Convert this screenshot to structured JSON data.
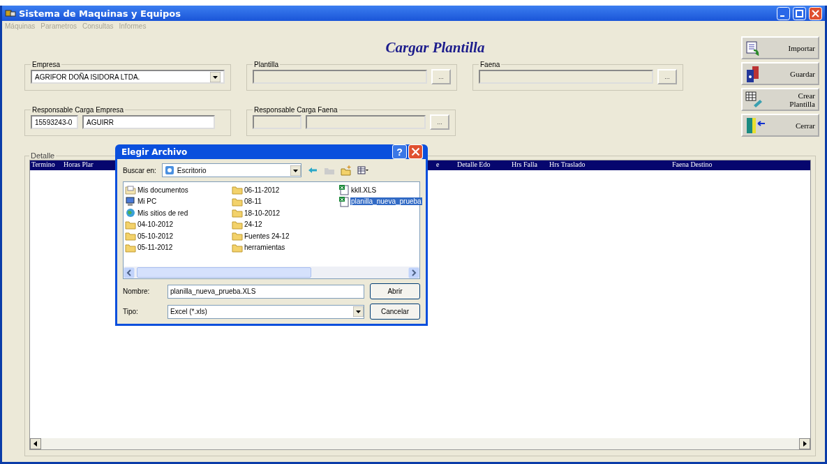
{
  "window": {
    "title": "Sistema de Maquinas y Equipos"
  },
  "menu": [
    {
      "label": "Máquinas"
    },
    {
      "label": "Parametros"
    },
    {
      "label": "Consultas"
    },
    {
      "label": "Informes"
    }
  ],
  "form": {
    "title": "Cargar Plantilla",
    "empresa": {
      "label": "Empresa",
      "value": "AGRIFOR DOÑA ISIDORA LTDA."
    },
    "plantilla": {
      "label": "Plantilla",
      "browse": "..."
    },
    "faena": {
      "label": "Faena",
      "browse": "..."
    },
    "responsable_empresa": {
      "label": "Responsable Carga Empresa",
      "rut": "15593243-0",
      "name": "AGUIRR"
    },
    "responsable_faena": {
      "label": "Responsable Carga Faena",
      "browse": "..."
    }
  },
  "actions": [
    {
      "label": "Importar",
      "kind": "import"
    },
    {
      "label": "Guardar",
      "kind": "save"
    },
    {
      "label": "Crear Plantilla",
      "kind": "create"
    },
    {
      "label": "Cerrar",
      "kind": "close"
    }
  ],
  "detalle": {
    "label": "Detalle",
    "columns": [
      "Termino",
      "Horas Plar",
      "e",
      "Detalle Edo",
      "Hrs Falla",
      "Hrs Traslado",
      "Faena Destino"
    ]
  },
  "dialog": {
    "title": "Elegir Archivo",
    "help": "?",
    "look_in_label": "Buscar en:",
    "look_in": "Escritorio",
    "files": [
      {
        "name": "Mis documentos",
        "kind": "documents",
        "selected": false
      },
      {
        "name": "Mi PC",
        "kind": "computer",
        "selected": false
      },
      {
        "name": "Mis sitios de red",
        "kind": "network",
        "selected": false
      },
      {
        "name": "04-10-2012",
        "kind": "folder",
        "selected": false
      },
      {
        "name": "05-10-2012",
        "kind": "folder",
        "selected": false
      },
      {
        "name": "05-11-2012",
        "kind": "folder",
        "selected": false
      },
      {
        "name": "06-11-2012",
        "kind": "folder",
        "selected": false
      },
      {
        "name": "08-11",
        "kind": "folder",
        "selected": false
      },
      {
        "name": "18-10-2012",
        "kind": "folder",
        "selected": false
      },
      {
        "name": "24-12",
        "kind": "folder",
        "selected": false
      },
      {
        "name": "Fuentes 24-12",
        "kind": "folder",
        "selected": false
      },
      {
        "name": "herramientas",
        "kind": "folder",
        "selected": false
      },
      {
        "name": "kkll.XLS",
        "kind": "excel",
        "selected": false
      },
      {
        "name": "planilla_nueva_prueba",
        "kind": "excel",
        "selected": true
      }
    ],
    "name_label": "Nombre:",
    "name_value": "planilla_nueva_prueba.XLS",
    "type_label": "Tipo:",
    "type_value": "Excel (*.xls)",
    "open": "Abrir",
    "cancel": "Cancelar"
  }
}
